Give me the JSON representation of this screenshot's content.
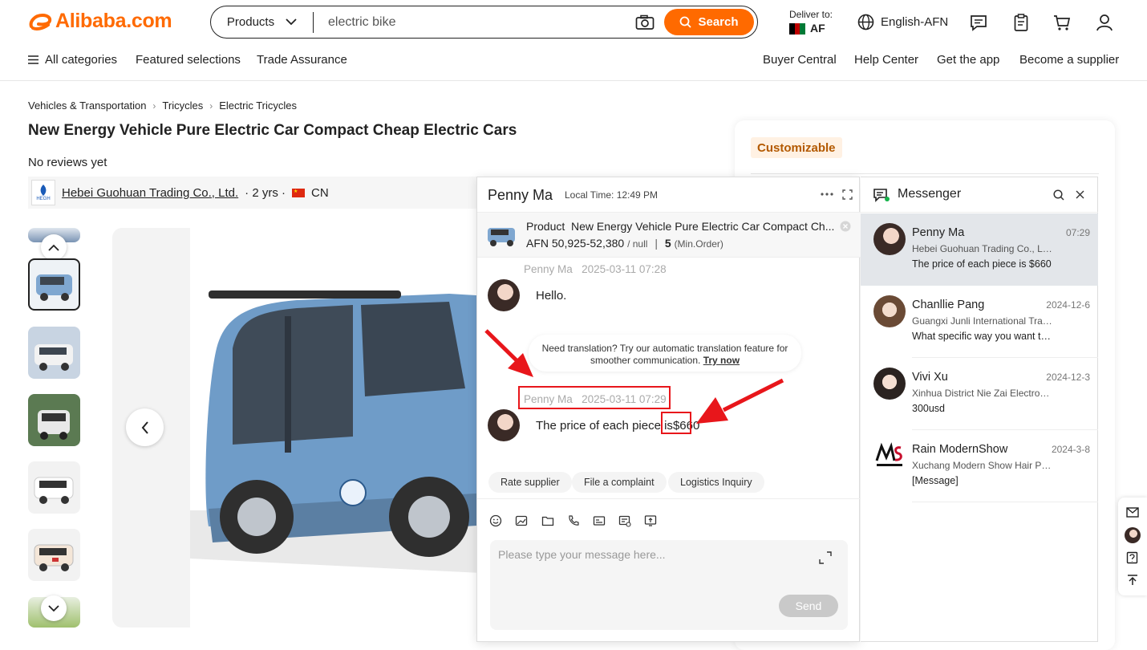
{
  "brand": {
    "name": "Alibaba.com",
    "color": "#ff6a00"
  },
  "search": {
    "category": "Products",
    "query": "electric bike",
    "button": "Search"
  },
  "deliver": {
    "label": "Deliver to:",
    "country": "AF"
  },
  "language": "English-AFN",
  "nav_left": [
    "All categories",
    "Featured selections",
    "Trade Assurance"
  ],
  "nav_right": [
    "Buyer Central",
    "Help Center",
    "Get the app",
    "Become a supplier"
  ],
  "breadcrumb": [
    "Vehicles & Transportation",
    "Tricycles",
    "Electric Tricycles"
  ],
  "product": {
    "title": "New Energy Vehicle Pure Electric Car Compact Cheap Electric Cars",
    "reviews": "No reviews yet",
    "supplier": "Hebei Guohuan Trading Co., Ltd.",
    "years": "· 2 yrs ·",
    "country": "CN",
    "badge": "Customizable",
    "supplier_logo_text": "HEGH"
  },
  "chat": {
    "contact": "Penny Ma",
    "local_time": "Local Time: 12:49 PM",
    "product_label": "Product",
    "product_name": "New Energy Vehicle Pure Electric Car Compact Ch...",
    "price": "AFN 50,925-52,380",
    "price_unit": "/ null",
    "divider": "|",
    "moq": "5",
    "moq_label": "(Min.Order)",
    "messages": [
      {
        "sender": "Penny Ma",
        "time": "2025-03-11 07:28",
        "text": "Hello."
      },
      {
        "sender": "Penny Ma",
        "time": "2025-03-11 07:29",
        "text": "The price of each piece is ",
        "highlight": "$660"
      }
    ],
    "translation_notice": "Need translation? Try our automatic translation feature for smoother communication.",
    "translation_link": "Try now",
    "actions": [
      "Rate supplier",
      "File a complaint",
      "Logistics Inquiry"
    ],
    "input_placeholder": "Please type your message here...",
    "send": "Send"
  },
  "messenger": {
    "title": "Messenger",
    "conversations": [
      {
        "name": "Penny Ma",
        "time": "07:29",
        "company": "Hebei Guohuan Trading Co., Ltd.",
        "last": "The price of each piece is $660"
      },
      {
        "name": "Chanllie Pang",
        "time": "2024-12-6",
        "company": "Guangxi Junli International Trad...",
        "last": "What specific way you want the..."
      },
      {
        "name": "Vivi Xu",
        "time": "2024-12-3",
        "company": "Xinhua District Nie Zai Electroni...",
        "last": "300usd"
      },
      {
        "name": "Rain ModernShow",
        "time": "2024-3-8",
        "company": "Xuchang Modern Show Hair Pro...",
        "last": "[Message]"
      }
    ]
  },
  "annotation_color": "#e8161b"
}
